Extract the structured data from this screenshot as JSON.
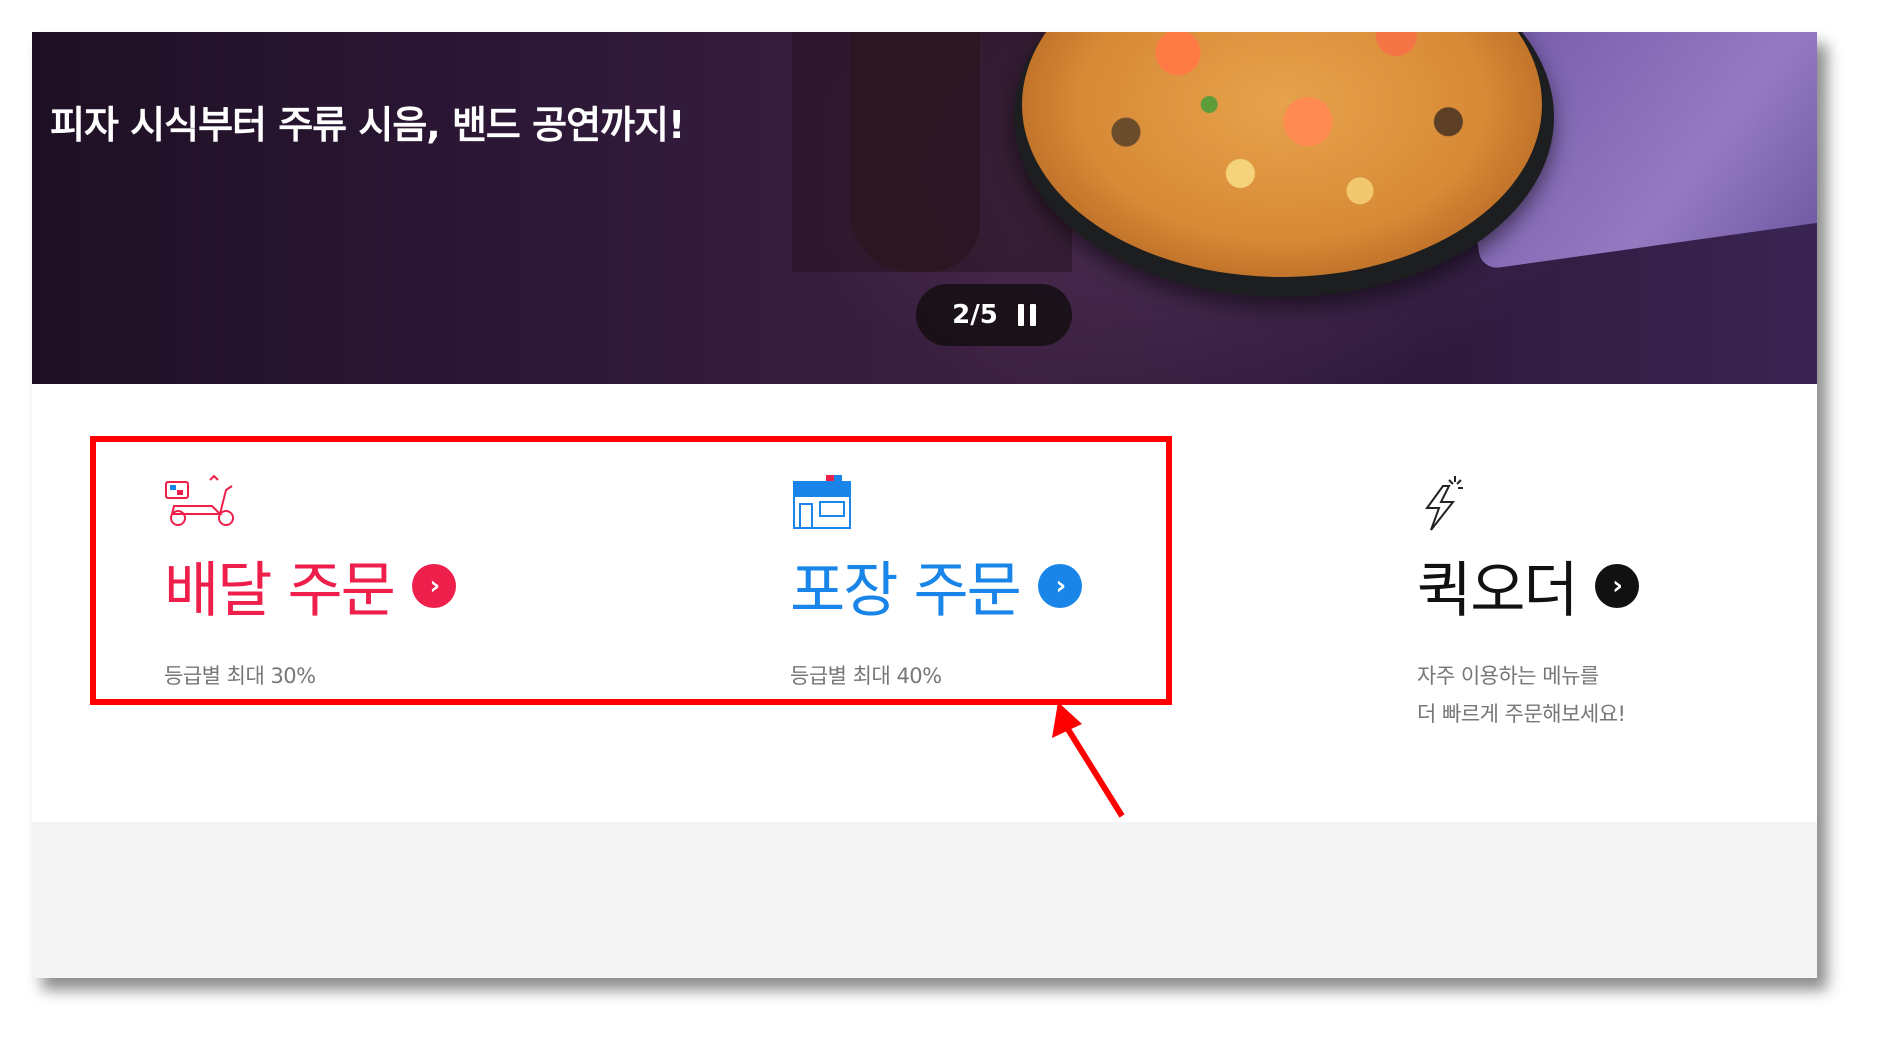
{
  "hero": {
    "headline": "피자 시식부터 주류 시음, 밴드 공연까지!",
    "slide_current": "2",
    "slide_separator": "/",
    "slide_total": "5",
    "pause_icon": "pause-icon"
  },
  "orders": {
    "delivery": {
      "icon": "scooter-icon",
      "title": "배달 주문",
      "arrow": "›",
      "desc_line1": "등급별 최대 30%",
      "color": "#ee1f4b"
    },
    "takeout": {
      "icon": "store-icon",
      "title": "포장 주문",
      "arrow": "›",
      "desc_line1": "등급별 최대 40%",
      "color": "#1a85e8"
    },
    "quick": {
      "icon": "lightning-icon",
      "title": "퀵오더",
      "arrow": "›",
      "desc_line1": "자주 이용하는 메뉴를",
      "desc_line2": "더 빠르게 주문해보세요!",
      "color": "#111111"
    }
  },
  "annotation": {
    "box_color": "#ff0000",
    "arrow_color": "#ff0000"
  }
}
